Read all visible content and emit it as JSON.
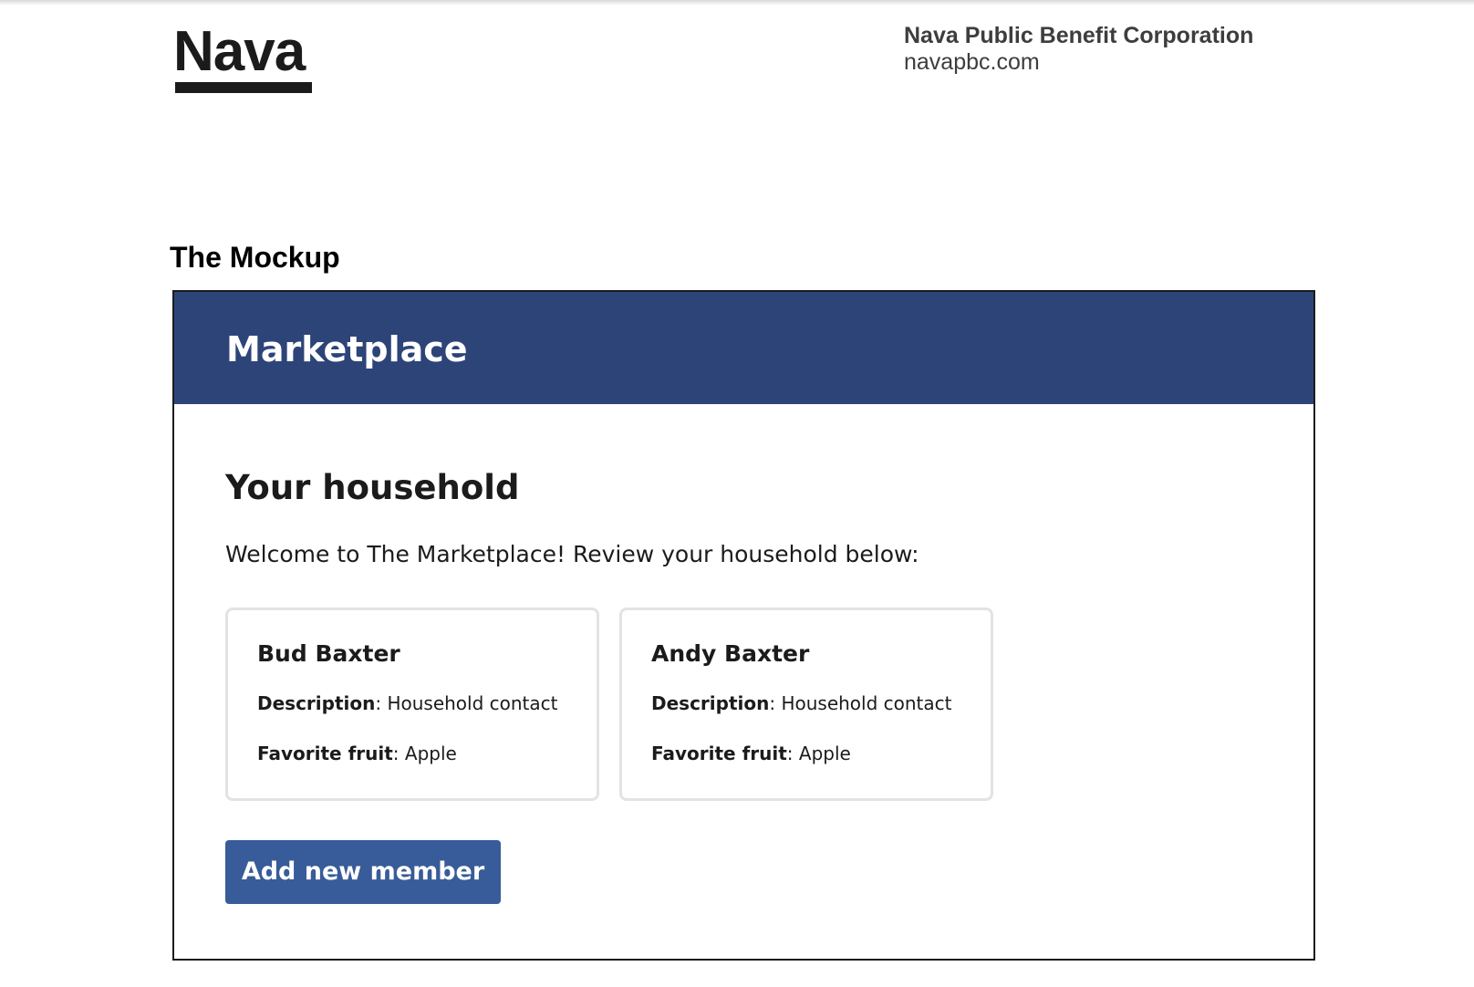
{
  "brand": {
    "logo_text": "Nava"
  },
  "org": {
    "name": "Nava Public Benefit Corporation",
    "url": "navapbc.com"
  },
  "section": {
    "title": "The Mockup"
  },
  "mockup": {
    "header_title": "Marketplace",
    "heading": "Your household",
    "welcome": "Welcome to The Marketplace! Review your household below:",
    "members": [
      {
        "name": "Bud Baxter",
        "description_label": "Description",
        "description_value": ": Household contact",
        "fruit_label": "Favorite fruit",
        "fruit_value": ": Apple"
      },
      {
        "name": "Andy Baxter",
        "description_label": "Description",
        "description_value": ": Household contact",
        "fruit_label": "Favorite fruit",
        "fruit_value": ": Apple"
      }
    ],
    "add_button_label": "Add new member"
  },
  "colors": {
    "header_bg": "#2d4478",
    "button_bg": "#385c99",
    "card_border": "#e3e3e3"
  }
}
